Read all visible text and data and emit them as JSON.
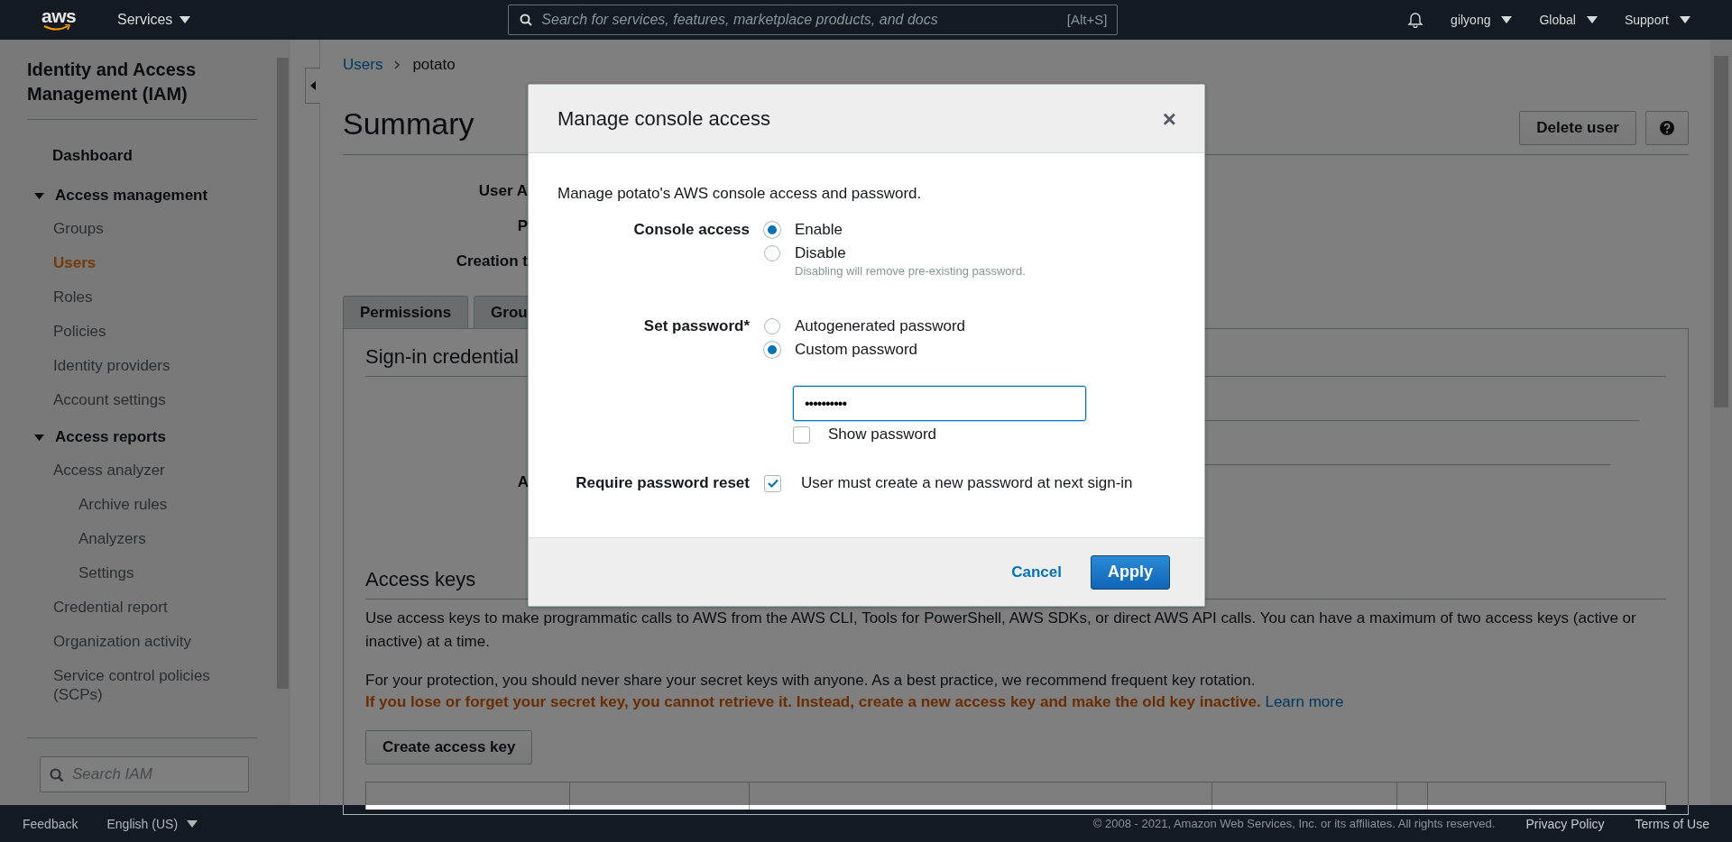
{
  "top_nav": {
    "logo": "aws",
    "services": "Services",
    "search": {
      "placeholder": "Search for services, features, marketplace products, and docs"
    },
    "shortcut": "[Alt+S]",
    "account": "gilyong",
    "region": "Global",
    "support": "Support"
  },
  "sidebar": {
    "title": "Identity and Access Management (IAM)",
    "items": [
      {
        "label": "Dashboard",
        "kind": "home",
        "selected": false
      },
      {
        "label": "Access management",
        "kind": "section",
        "expanded": true,
        "children": [
          {
            "label": "Groups",
            "selected": false
          },
          {
            "label": "Users",
            "selected": true
          },
          {
            "label": "Roles",
            "selected": false
          },
          {
            "label": "Policies",
            "selected": false
          },
          {
            "label": "Identity providers",
            "selected": false
          },
          {
            "label": "Account settings",
            "selected": false
          }
        ]
      },
      {
        "label": "Access reports",
        "kind": "section",
        "expanded": true,
        "children": [
          {
            "label": "Access analyzer",
            "selected": false,
            "children": [
              {
                "label": "Archive rules",
                "selected": false
              },
              {
                "label": "Analyzers",
                "selected": false
              },
              {
                "label": "Settings",
                "selected": false
              }
            ]
          },
          {
            "label": "Credential report",
            "selected": false
          },
          {
            "label": "Organization activity",
            "selected": false
          },
          {
            "label": "Service control policies (SCPs)",
            "selected": false
          }
        ]
      }
    ],
    "search": {
      "placeholder": "Search IAM"
    }
  },
  "main": {
    "breadcrumb": [
      {
        "label": "Users",
        "kind": "link"
      },
      {
        "label": "potato",
        "kind": "current"
      }
    ],
    "title": "Summary",
    "delete_button": "Delete user",
    "summary_labels": [
      "User A",
      "P",
      "Creation t"
    ],
    "tabs": [
      {
        "label": "Permissions",
        "selected": false
      },
      {
        "label": "Grou",
        "selected": false
      }
    ],
    "sign_in_heading": "Sign-in credential",
    "sign_in_label": "A",
    "access_keys": {
      "heading": "Access keys",
      "description": "Use access keys to make programmatic calls to AWS from the AWS CLI, Tools for PowerShell, AWS SDKs, or direct AWS API calls. You can have a maximum of two access keys (active or inactive) at a time.",
      "protection": "For your protection, you should never share your secret keys with anyone. As a best practice, we recommend frequent key rotation.",
      "warning": "If you lose or forget your secret key, you cannot retrieve it. Instead, create a new access key and make the old key inactive.",
      "learn_more": "Learn more",
      "button": "Create access key"
    }
  },
  "dialog": {
    "title": "Manage console access",
    "close": "×",
    "intro": "Manage potato's AWS console access and password.",
    "console_access": {
      "label": "Console access",
      "options": [
        {
          "label": "Enable",
          "selected": true
        },
        {
          "label": "Disable",
          "selected": false,
          "hint": "Disabling will remove pre-existing password."
        }
      ]
    },
    "set_password": {
      "label": "Set password*",
      "options": [
        {
          "label": "Autogenerated password",
          "selected": false
        },
        {
          "label": "Custom password",
          "selected": true
        }
      ],
      "password": {
        "value": "••••••••••"
      },
      "show_password": {
        "label": "Show password",
        "checked": false
      }
    },
    "require_reset": {
      "label": "Require password reset",
      "checked": true,
      "text": "User must create a new password at next sign-in"
    },
    "buttons": [
      {
        "label": "Cancel",
        "kind": "link"
      },
      {
        "label": "Apply",
        "kind": "primary"
      }
    ]
  },
  "footer": {
    "feedback": "Feedback",
    "language": "English (US)",
    "copyright": "© 2008 - 2021, Amazon Web Services, Inc. or its affiliates. All rights reserved.",
    "links": [
      "Privacy Policy",
      "Terms of Use"
    ]
  }
}
